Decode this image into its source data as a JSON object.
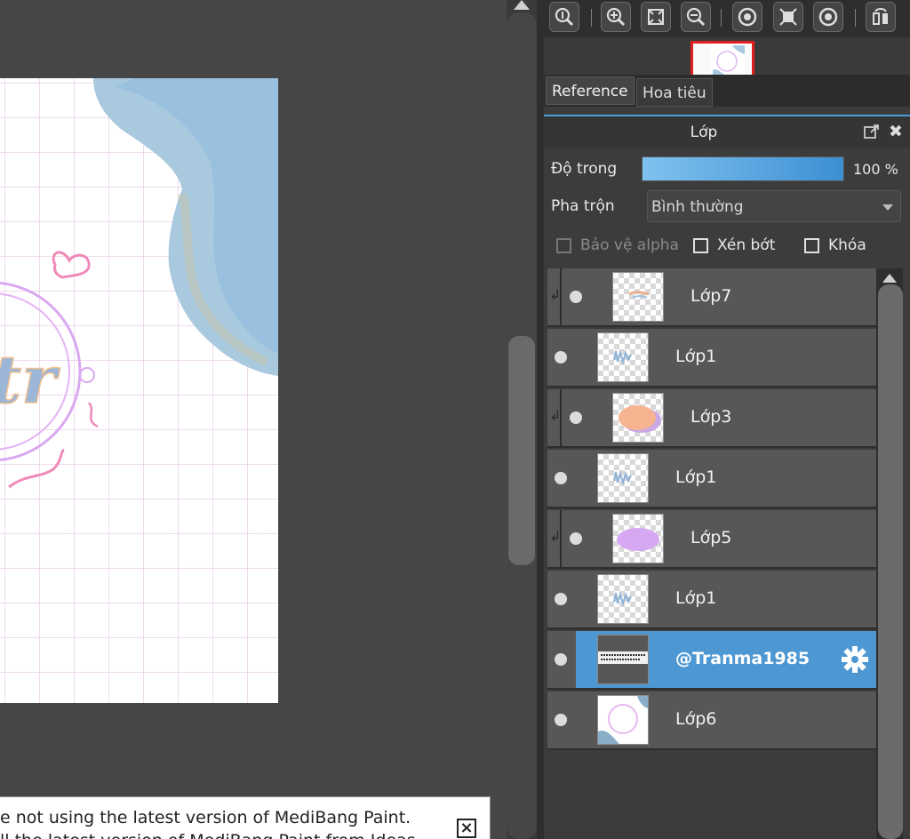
{
  "banner": {
    "line1": "e not using the latest version of MediBang Paint.",
    "line2": "ll the latest version of MediBang Paint from Ideas",
    "close_glyph": "×"
  },
  "tabs": [
    {
      "label": "Reference"
    },
    {
      "label": "Hoa tiêu"
    }
  ],
  "layer_panel": {
    "title": "Lớp",
    "opacity_label": "Độ trong",
    "opacity_value": "100 %",
    "opacity_fraction": 1.0,
    "blend_label": "Pha trộn",
    "blend_value": "Bình thường",
    "protect_alpha_label": "Bảo vệ alpha",
    "clipping_label": "Xén bớt",
    "lock_label": "Khóa",
    "accent_color": "#4d97d2"
  },
  "layers": [
    {
      "name": "Lớp7",
      "clipped": true,
      "thumb": "small-orange-scribble"
    },
    {
      "name": "Lớp1",
      "clipped": false,
      "thumb": "blue-text-scribble"
    },
    {
      "name": "Lớp3",
      "clipped": true,
      "thumb": "peach-blob"
    },
    {
      "name": "Lớp1",
      "clipped": false,
      "thumb": "blue-text-scribble"
    },
    {
      "name": "Lớp5",
      "clipped": true,
      "thumb": "purple-blob"
    },
    {
      "name": "Lớp1",
      "clipped": false,
      "thumb": "blue-text-scribble"
    },
    {
      "name": "@Tranma1985",
      "clipped": false,
      "selected": true,
      "thumb": "text-stamp"
    },
    {
      "name": "Lớp6",
      "clipped": false,
      "thumb": "circle-frame"
    }
  ],
  "toolbar_icons": [
    "zoom-actual-icon",
    "zoom-in-icon",
    "fit-window-icon",
    "zoom-out-icon",
    "rotate-left-icon",
    "full-screen-icon",
    "rotate-right-icon",
    "flip-icon"
  ]
}
